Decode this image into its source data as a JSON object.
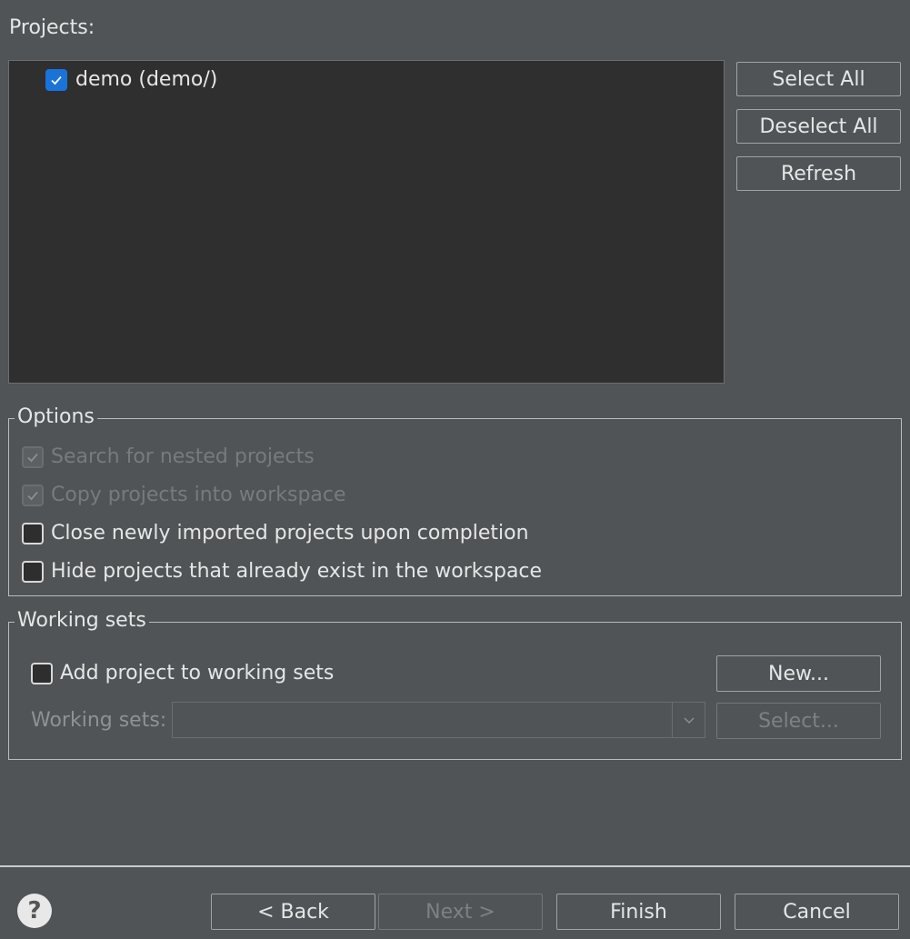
{
  "projects_label": "Projects:",
  "projects": [
    {
      "label": "demo (demo/)",
      "checked": true
    }
  ],
  "side_buttons": {
    "select_all": "Select All",
    "deselect_all": "Deselect All",
    "refresh": "Refresh"
  },
  "options": {
    "title": "Options",
    "search_nested": "Search for nested projects",
    "copy_into_workspace": "Copy projects into workspace",
    "close_imported": "Close newly imported projects upon completion",
    "hide_existing": "Hide projects that already exist in the workspace"
  },
  "working_sets": {
    "title": "Working sets",
    "add_to_working_sets": "Add project to working sets",
    "new_button": "New...",
    "label": "Working sets:",
    "select_button": "Select..."
  },
  "footer": {
    "help": "?",
    "back": "< Back",
    "next": "Next >",
    "finish": "Finish",
    "cancel": "Cancel"
  },
  "colors": {
    "background": "#505457",
    "tree_background": "#2f2f2f",
    "checkbox_accent": "#1a73d9"
  }
}
